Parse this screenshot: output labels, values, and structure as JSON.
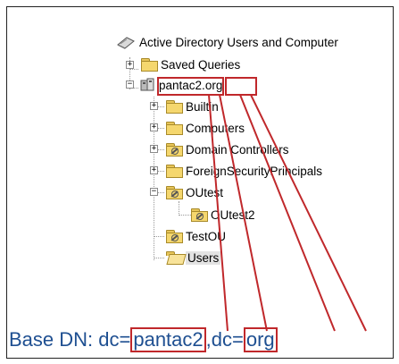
{
  "tree": {
    "root_label": "Active Directory Users and Computer",
    "saved_queries": "Saved Queries",
    "domain_part1": "pantac2",
    "domain_sep": ".",
    "domain_part2": "org",
    "builtin": "Builtin",
    "computers": "Computers",
    "domain_controllers": "Domain Controllers",
    "foreign": "ForeignSecurityPrincipals",
    "outest": "OUtest",
    "outest2": "OUtest2",
    "testou": "TestOU",
    "users": "Users"
  },
  "caption": {
    "prefix": "Base DN: dc=",
    "dc1": "pantac2",
    "mid": ",dc=",
    "dc2": "org"
  },
  "colors": {
    "highlight": "#c0282b",
    "caption_text": "#1e4f91"
  }
}
